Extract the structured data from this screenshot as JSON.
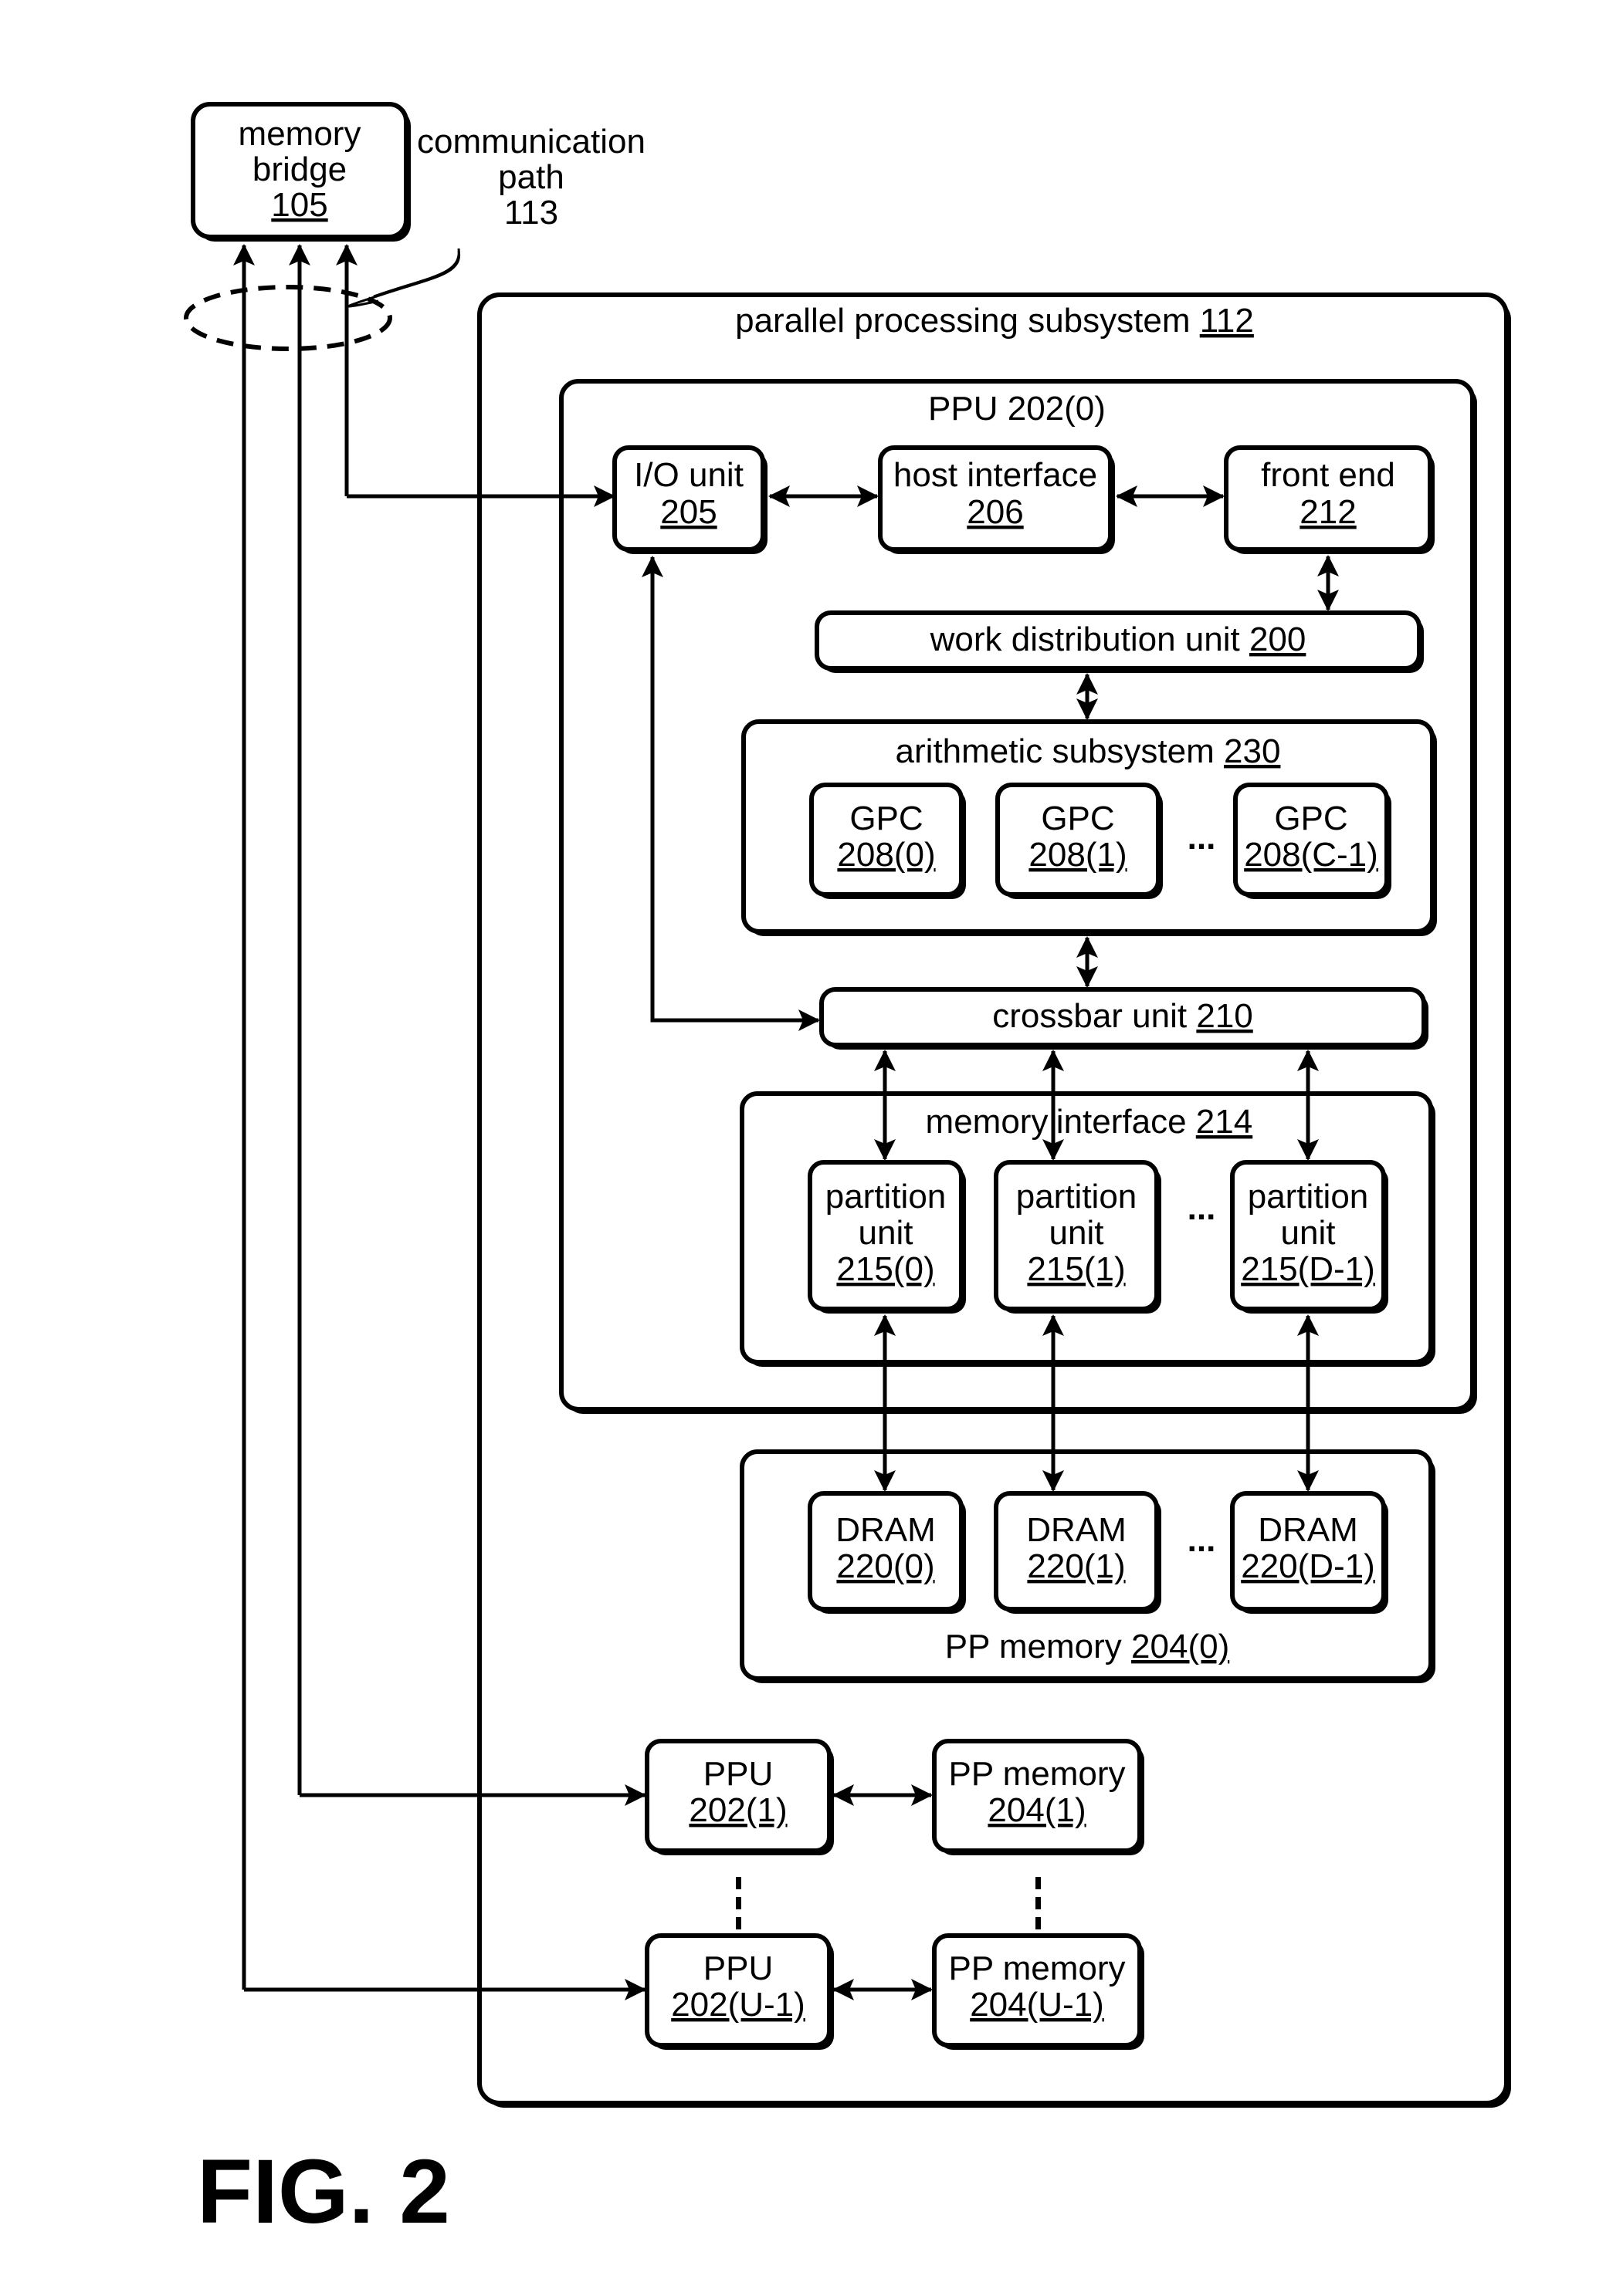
{
  "figure_label": "FIG. 2",
  "memory_bridge": {
    "line1": "memory",
    "line2": "bridge",
    "ref": "105"
  },
  "communication_path": {
    "line1": "communication",
    "line2": "path",
    "ref": "113"
  },
  "parallel_processing_subsystem": {
    "label": "parallel processing subsystem ",
    "ref": "112"
  },
  "ppu0": {
    "label": "PPU 202(0)"
  },
  "io_unit": {
    "line1": "I/O unit",
    "ref": "205"
  },
  "host_interface": {
    "line1": "host interface",
    "ref": "206"
  },
  "front_end": {
    "line1": "front end",
    "ref": "212"
  },
  "work_distribution_unit": {
    "label": "work distribution unit ",
    "ref": "200"
  },
  "arithmetic_subsystem": {
    "label": "arithmetic subsystem ",
    "ref": "230"
  },
  "gpcs": [
    {
      "line1": "GPC",
      "ref": "208(0)"
    },
    {
      "line1": "GPC",
      "ref": "208(1)"
    },
    {
      "line1": "GPC",
      "ref": "208(C-1)"
    }
  ],
  "crossbar_unit": {
    "label": "crossbar unit ",
    "ref": "210"
  },
  "memory_interface": {
    "label_a": "memory",
    "label_b": "interface ",
    "ref": "214"
  },
  "partition_units": [
    {
      "line1": "partition",
      "line2": "unit",
      "ref": "215(0)"
    },
    {
      "line1": "partition",
      "line2": "unit",
      "ref": "215(1)"
    },
    {
      "line1": "partition",
      "line2": "unit",
      "ref": "215(D-1)"
    }
  ],
  "drams": [
    {
      "line1": "DRAM",
      "ref": "220(0)"
    },
    {
      "line1": "DRAM",
      "ref": "220(1)"
    },
    {
      "line1": "DRAM",
      "ref": "220(D-1)"
    }
  ],
  "pp_memory0": {
    "label": "PP memory ",
    "ref": "204(0)"
  },
  "ppu1": {
    "line1": "PPU",
    "ref": "202(1)"
  },
  "pp_memory1": {
    "line1": "PP memory",
    "ref": "204(1)"
  },
  "ppu_last": {
    "line1": "PPU",
    "ref": "202(U-1)"
  },
  "pp_memory_last": {
    "line1": "PP memory",
    "ref": "204(U-1)"
  },
  "ellipsis": "..."
}
